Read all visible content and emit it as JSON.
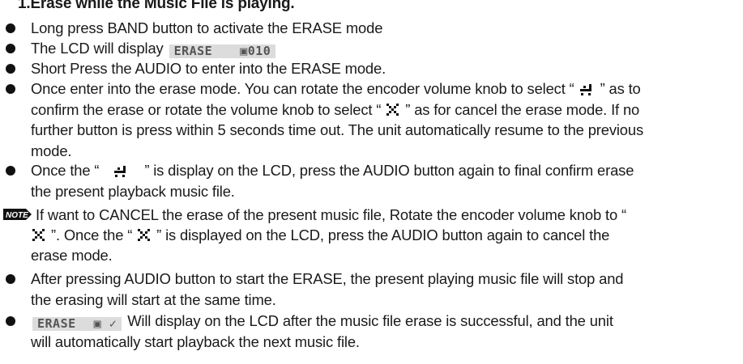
{
  "heading": "1.Erase while the Music File is playing.",
  "items": [
    {
      "text": "Long press BAND button to activate the ERASE mode"
    },
    {
      "text_before": "The LCD will display",
      "lcd_left": "ERASE",
      "lcd_right": "▣010"
    },
    {
      "text": "Short Press the AUDIO to enter into the ERASE mode."
    },
    {
      "lines": [
        "Once enter into the erase mode. You can rotate the encoder volume knob to select “",
        "” as to",
        "confirm the erase or rotate the volume knob to select “",
        "” as for cancel the erase mode. If no",
        "further button is press within 5 seconds time out. The unit automatically resume to the previous",
        "mode."
      ]
    },
    {
      "parts": [
        "Once the “",
        "” is display on the LCD, press the AUDIO button again to final confirm  erase",
        "the present playback music file."
      ]
    }
  ],
  "note": {
    "badge": "NOTE",
    "parts": [
      "If want to CANCEL the erase of the present music file, Rotate the encoder volume knob to “",
      "”.  Once the “",
      "” is displayed on the LCD, press the AUDIO button again to cancel the",
      "erase mode."
    ]
  },
  "items2": [
    {
      "lines": [
        "After pressing AUDIO button to start the ERASE, the present playing music file will stop and",
        "the erasing will start at the same time."
      ]
    },
    {
      "lcd_left": "ERASE",
      "lcd_right": "▣ ✓",
      "lines": [
        "Will display on the LCD after the music file erase is successful, and the unit",
        "will automatically start playback the next music file."
      ]
    }
  ],
  "icons": {
    "confirm": "confirm-erase-icon",
    "cancel": "cancel-erase-icon",
    "note": "note-badge-icon"
  }
}
